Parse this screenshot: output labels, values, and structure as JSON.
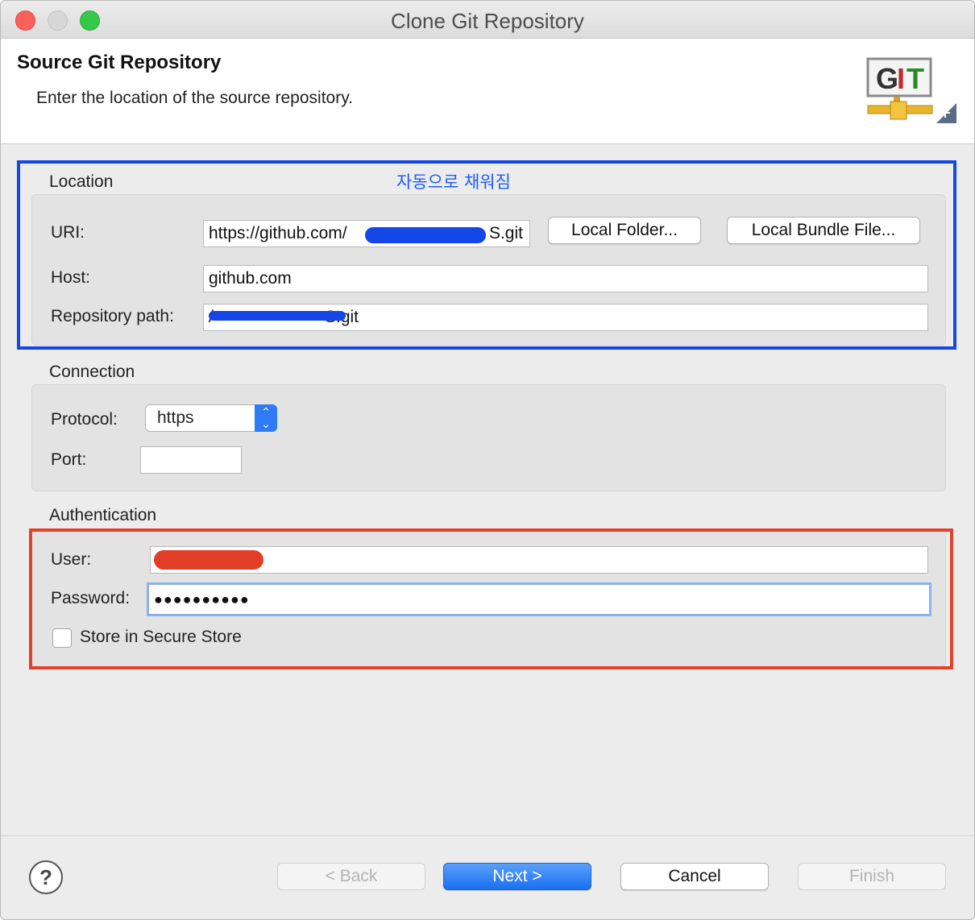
{
  "window": {
    "title": "Clone Git Repository"
  },
  "banner": {
    "title": "Source Git Repository",
    "subtitle": "Enter the location of the source repository.",
    "logo_text_g": "G",
    "logo_text_i": "I",
    "logo_text_t": "T"
  },
  "annotation": {
    "auto_filled": "자동으로 채워짐"
  },
  "location": {
    "heading": "Location",
    "uri_label": "URI:",
    "uri_value": "https://github.com/",
    "uri_suffix": "S.git",
    "local_folder_button": "Local Folder...",
    "local_bundle_button": "Local Bundle File...",
    "host_label": "Host:",
    "host_value": "github.com",
    "repo_path_label": "Repository path:",
    "repo_path_value": "/",
    "repo_path_suffix": "S.git"
  },
  "connection": {
    "heading": "Connection",
    "protocol_label": "Protocol:",
    "protocol_value": "https",
    "port_label": "Port:",
    "port_value": ""
  },
  "authentication": {
    "heading": "Authentication",
    "user_label": "User:",
    "password_label": "Password:",
    "password_value": "●●●●●●●●●●",
    "store_label": "Store in Secure Store",
    "store_checked": false
  },
  "footer": {
    "help": "?",
    "back": "< Back",
    "next": "Next >",
    "cancel": "Cancel",
    "finish": "Finish"
  },
  "colors": {
    "annotation_blue": "#1447e6",
    "annotation_red": "#e4412a",
    "primary_button": "#1a6ff0"
  }
}
